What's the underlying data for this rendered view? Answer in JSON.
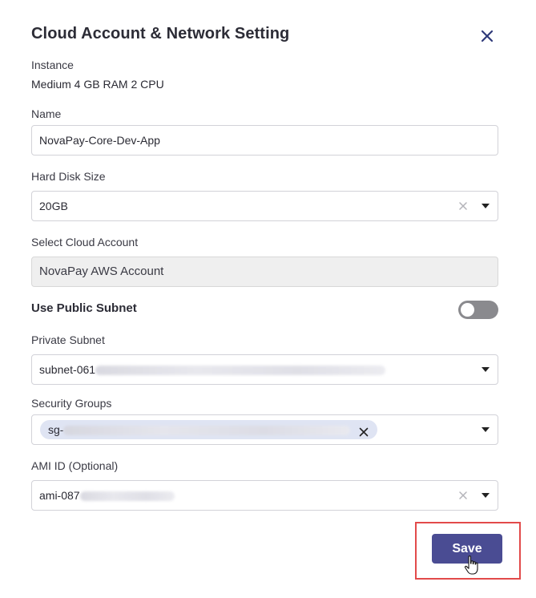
{
  "dialog": {
    "title": "Cloud Account & Network Setting",
    "close_icon": "close-icon"
  },
  "instance": {
    "label": "Instance",
    "value": "Medium 4 GB RAM 2 CPU"
  },
  "name": {
    "label": "Name",
    "value": "NovaPay-Core-Dev-App"
  },
  "hard_disk": {
    "label": "Hard Disk Size",
    "value": "20GB"
  },
  "cloud_account": {
    "label": "Select Cloud Account",
    "value": "NovaPay AWS Account"
  },
  "public_subnet": {
    "label": "Use Public Subnet",
    "enabled": false
  },
  "private_subnet": {
    "label": "Private Subnet",
    "value_prefix": "subnet-061"
  },
  "security_groups": {
    "label": "Security Groups",
    "chip_prefix": "sg-"
  },
  "ami": {
    "label": "AMI ID (Optional)",
    "value_prefix": "ami-087"
  },
  "footer": {
    "save_label": "Save"
  },
  "colors": {
    "accent": "#4a4c93",
    "highlight_border": "#e24a4a",
    "toggle_off": "#8a8a8e",
    "chip_bg": "#dfe4f3"
  }
}
